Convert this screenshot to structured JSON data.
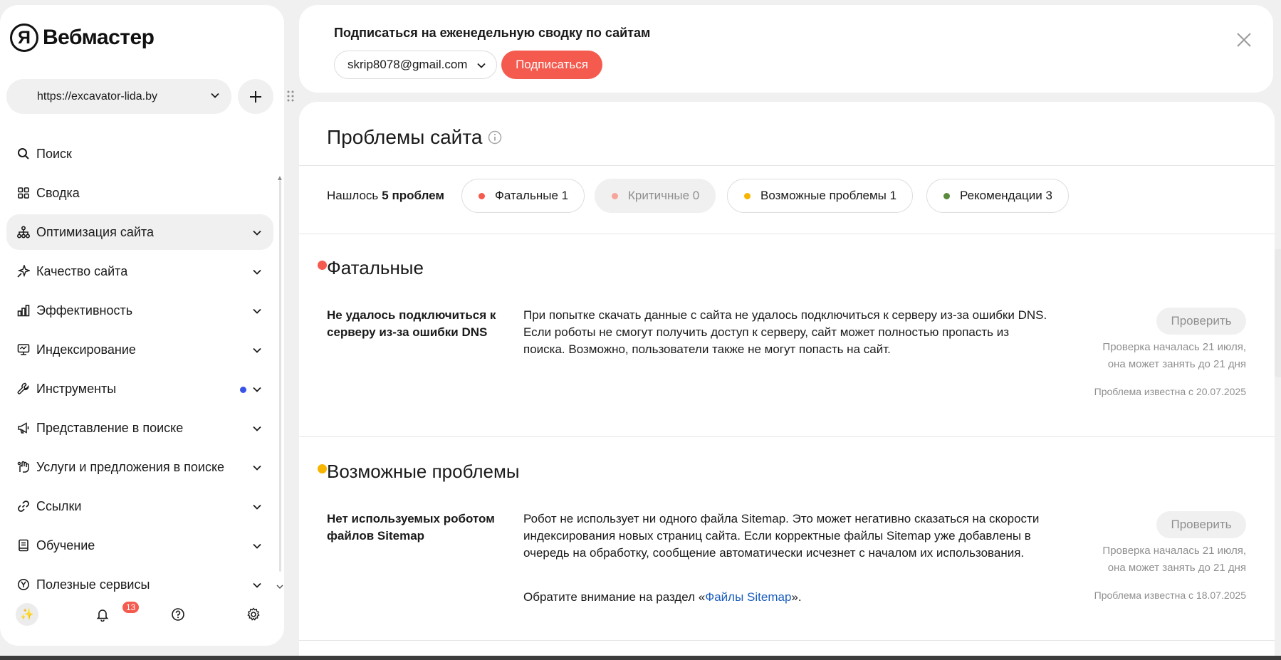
{
  "app": {
    "logo_letter": "Я",
    "logo_text": "Вебмастер"
  },
  "site_selector": {
    "value": "https://excavator-lida.by"
  },
  "sidebar": {
    "items": [
      {
        "label": "Поиск",
        "icon": "search-icon",
        "expandable": false
      },
      {
        "label": "Сводка",
        "icon": "dashboard-icon",
        "expandable": false
      },
      {
        "label": "Оптимизация сайта",
        "icon": "sitemap-icon",
        "expandable": true,
        "active": true
      },
      {
        "label": "Качество сайта",
        "icon": "sparkle-pin-icon",
        "expandable": true
      },
      {
        "label": "Эффективность",
        "icon": "bar-chart-icon",
        "expandable": true
      },
      {
        "label": "Индексирование",
        "icon": "monitor-icon",
        "expandable": true
      },
      {
        "label": "Инструменты",
        "icon": "wrench-icon",
        "expandable": true,
        "has_dot": true
      },
      {
        "label": "Представление в поиске",
        "icon": "megaphone-icon",
        "expandable": true
      },
      {
        "label": "Услуги и предложения в поиске",
        "icon": "hand-icon",
        "expandable": true
      },
      {
        "label": "Ссылки",
        "icon": "link-icon",
        "expandable": true
      },
      {
        "label": "Обучение",
        "icon": "book-icon",
        "expandable": true
      },
      {
        "label": "Полезные сервисы",
        "icon": "compass-icon",
        "expandable": true
      }
    ],
    "notifications_count": "13"
  },
  "subscribe": {
    "title": "Подписаться на еженедельную сводку по сайтам",
    "email": "skrip8078@gmail.com",
    "button_label": "Подписаться"
  },
  "main": {
    "title": "Проблемы сайта",
    "summary_prefix": "Нашлось",
    "summary_count": "5 проблем",
    "filters": [
      {
        "label": "Фатальные 1",
        "color": "#f55a4e",
        "disabled": false
      },
      {
        "label": "Критичные 0",
        "color": "#f6a49c",
        "disabled": true
      },
      {
        "label": "Возможные проблемы 1",
        "color": "#f7b500",
        "disabled": false
      },
      {
        "label": "Рекомендации 3",
        "color": "#5a8a3c",
        "disabled": false
      }
    ],
    "sections": [
      {
        "title": "Фатальные",
        "color": "#f55a4e",
        "issue_name": "Не удалось подключиться к серверу из-за ошибки DNS",
        "description": "При попытке скачать данные с сайта не удалось подключиться к серверу из-за ошибки DNS. Если роботы не смогут получить доступ к серверу, сайт может полностью пропасть из поиска. Возможно, пользователи также не могут попасть на сайт.",
        "check_label": "Проверить",
        "check_status": "Проверка началась 21 июля, она может занять до 21 дня",
        "known_since": "Проблема известна с 20.07.2025"
      },
      {
        "title": "Возможные проблемы",
        "color": "#f7b500",
        "issue_name": "Нет используемых роботом файлов Sitemap",
        "description": "Робот не использует ни одного файла Sitemap. Это может негативно сказаться на скорости индексирования новых страниц сайта. Если корректные файлы Sitemap уже добавлены в очередь на обработку, сообщение автоматически исчезнет с началом их использования.",
        "note_prefix": "Обратите внимание на раздел «",
        "note_link": "Файлы Sitemap",
        "note_suffix": "».",
        "check_label": "Проверить",
        "check_status": "Проверка началась 21 июля, она может занять до 21 дня",
        "known_since": "Проблема известна с 18.07.2025"
      }
    ]
  }
}
